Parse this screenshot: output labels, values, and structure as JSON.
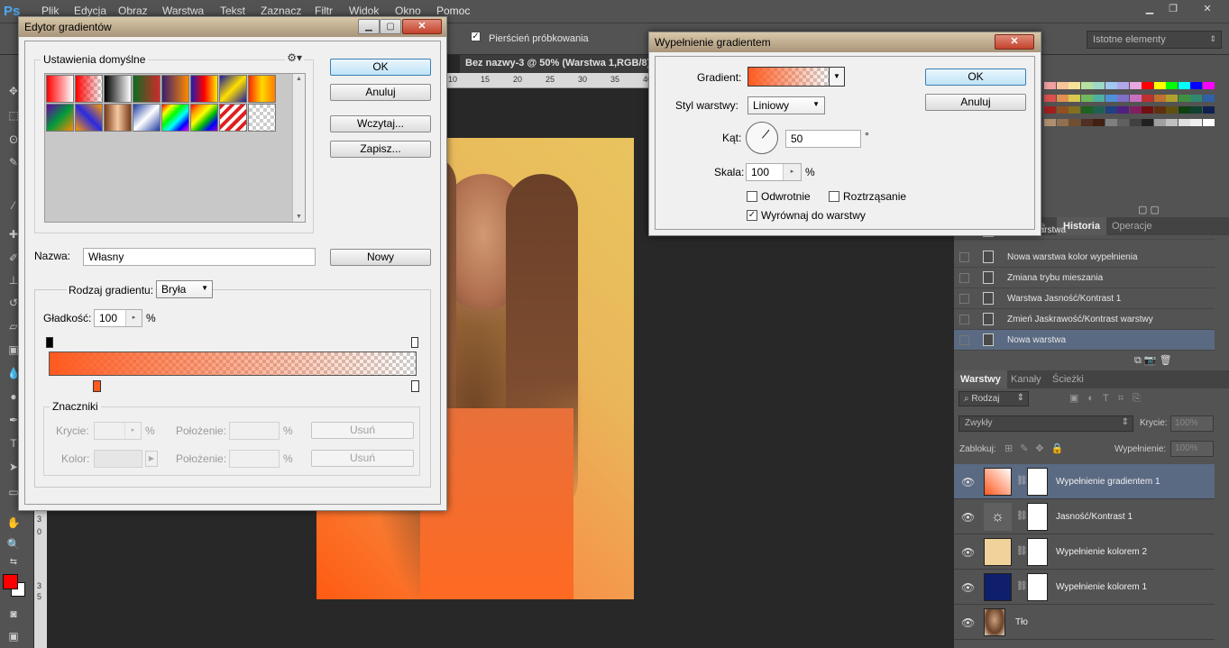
{
  "app": {
    "logo": "Ps"
  },
  "menu": [
    "Plik",
    "Edycja",
    "Obraz",
    "Warstwa",
    "Tekst",
    "Zaznacz",
    "Filtr",
    "Widok",
    "Okno",
    "Pomoc"
  ],
  "options": {
    "sampling_ring": "Pierścień próbkowania",
    "workspace": "Istotne elementy"
  },
  "document": {
    "tab_title": "Bez nazwy-3 @ 50% (Warstwa 1,RGB/8)",
    "ruler_ticks": [
      "10",
      "15",
      "20",
      "25",
      "30",
      "35",
      "40"
    ]
  },
  "vruler_ticks": [
    "3",
    "0",
    "3",
    "5"
  ],
  "colors": {
    "foreground": "#ff0000",
    "background": "#ffffff",
    "gradient_start": "#ff5a1f"
  },
  "gradient_editor": {
    "title": "Edytor gradientów",
    "presets_label": "Ustawienia domyślne",
    "ok": "OK",
    "cancel": "Anuluj",
    "load": "Wczytaj...",
    "save": "Zapisz...",
    "name_label": "Nazwa:",
    "name_value": "Własny",
    "new": "Nowy",
    "type_label": "Rodzaj gradientu:",
    "type_value": "Bryła",
    "smoothness_label": "Gładkość:",
    "smoothness_value": "100",
    "percent": "%",
    "stops": {
      "title": "Znaczniki",
      "opacity_label": "Krycie:",
      "location_label": "Położenie:",
      "color_label": "Kolor:",
      "delete": "Usuń",
      "percent": "%"
    }
  },
  "gradient_fill": {
    "title": "Wypełnienie gradientem",
    "gradient_label": "Gradient:",
    "style_label": "Styl warstwy:",
    "style_value": "Liniowy",
    "angle_label": "Kąt:",
    "angle_value": "50",
    "degree": "°",
    "scale_label": "Skala:",
    "scale_value": "100",
    "percent": "%",
    "reverse": "Odwrotnie",
    "dither": "Roztrząsanie",
    "align": "Wyrównaj do warstwy",
    "ok": "OK",
    "cancel": "Anuluj"
  },
  "history": {
    "tabs": [
      "e",
      "Historia",
      "Operacje"
    ],
    "items": [
      "Nowa warstwa",
      "Nowa warstwa kolor wypełnienia",
      "Zmiana trybu mieszania",
      "Warstwa Jasność/Kontrast 1",
      "Zmień Jaskrawość/Kontrast warstwy",
      "Nowa warstwa"
    ]
  },
  "layers": {
    "tabs": [
      "Warstwy",
      "Kanały",
      "Ścieżki"
    ],
    "filter": "Rodzaj",
    "blend": "Zwykły",
    "opacity_label": "Krycie:",
    "opacity_value": "100%",
    "lock_label": "Zablokuj:",
    "fill_label": "Wypełnienie:",
    "fill_value": "100%",
    "items": [
      "Wypełnienie gradientem 1",
      "Jasność/Kontrast 1",
      "Wypełnienie kolorem 2",
      "Wypełnienie kolorem 1",
      "Tło"
    ]
  }
}
